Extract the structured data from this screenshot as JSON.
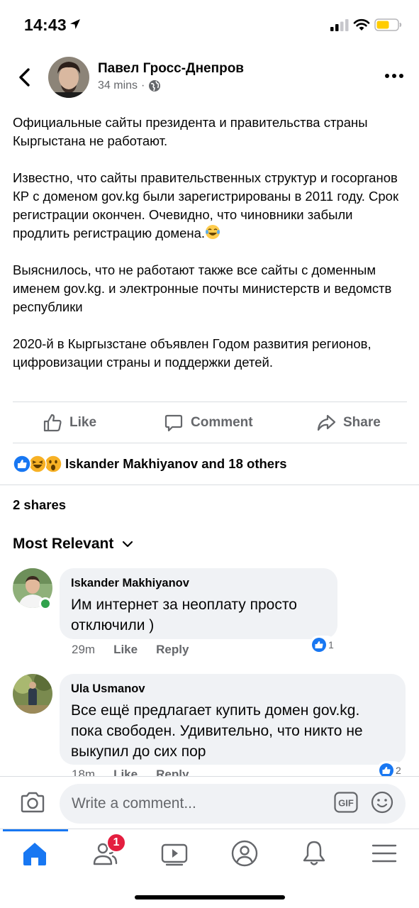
{
  "status_bar": {
    "time": "14:43"
  },
  "post": {
    "author": "Павел Гросс-Днепров",
    "time": "34 mins",
    "separator": "·",
    "paragraphs": [
      "Официальные сайты президента и правительства страны Кыргыстана  не работают.",
      "Известно, что сайты правительственных структур и госорганов КР с доменом gov.kg были зарегистрированы в 2011 году. Срок регистрации окончен. Очевидно, что чиновники забыли продлить регистрацию домена.",
      "Выяснилось, что не работают также все сайты с доменным именем gov.kg. и электронные почты министерств и ведомств республики",
      "2020-й в Кыргызстане объявлен Годом развития регионов, цифровизации страны и поддержки детей."
    ]
  },
  "actions": {
    "like": "Like",
    "comment": "Comment",
    "share": "Share"
  },
  "reactions": {
    "text": "Iskander Makhiyanov and 18 others"
  },
  "shares": "2 shares",
  "sort": {
    "label": "Most Relevant"
  },
  "comments": [
    {
      "name": "Iskander Makhiyanov",
      "text": "Им интернет за неоплату просто отключили )",
      "time": "29m",
      "like": "Like",
      "reply": "Reply",
      "likes": "1"
    },
    {
      "name": "Ula Usmanov",
      "text": "Все ещё предлагает купить домен gov.kg. пока свободен. Удивительно, что никто не выкупил до сих пор",
      "time": "18m",
      "like": "Like",
      "reply": "Reply",
      "likes": "2"
    }
  ],
  "composer": {
    "placeholder": "Write a comment...",
    "gif": "GIF"
  },
  "tabbar": {
    "friends_badge": "1"
  },
  "colors": {
    "accent": "#1877f2",
    "secondary_text": "#65676b",
    "bubble": "#f0f2f5",
    "badge": "#e41e3f",
    "online": "#31a24c"
  }
}
